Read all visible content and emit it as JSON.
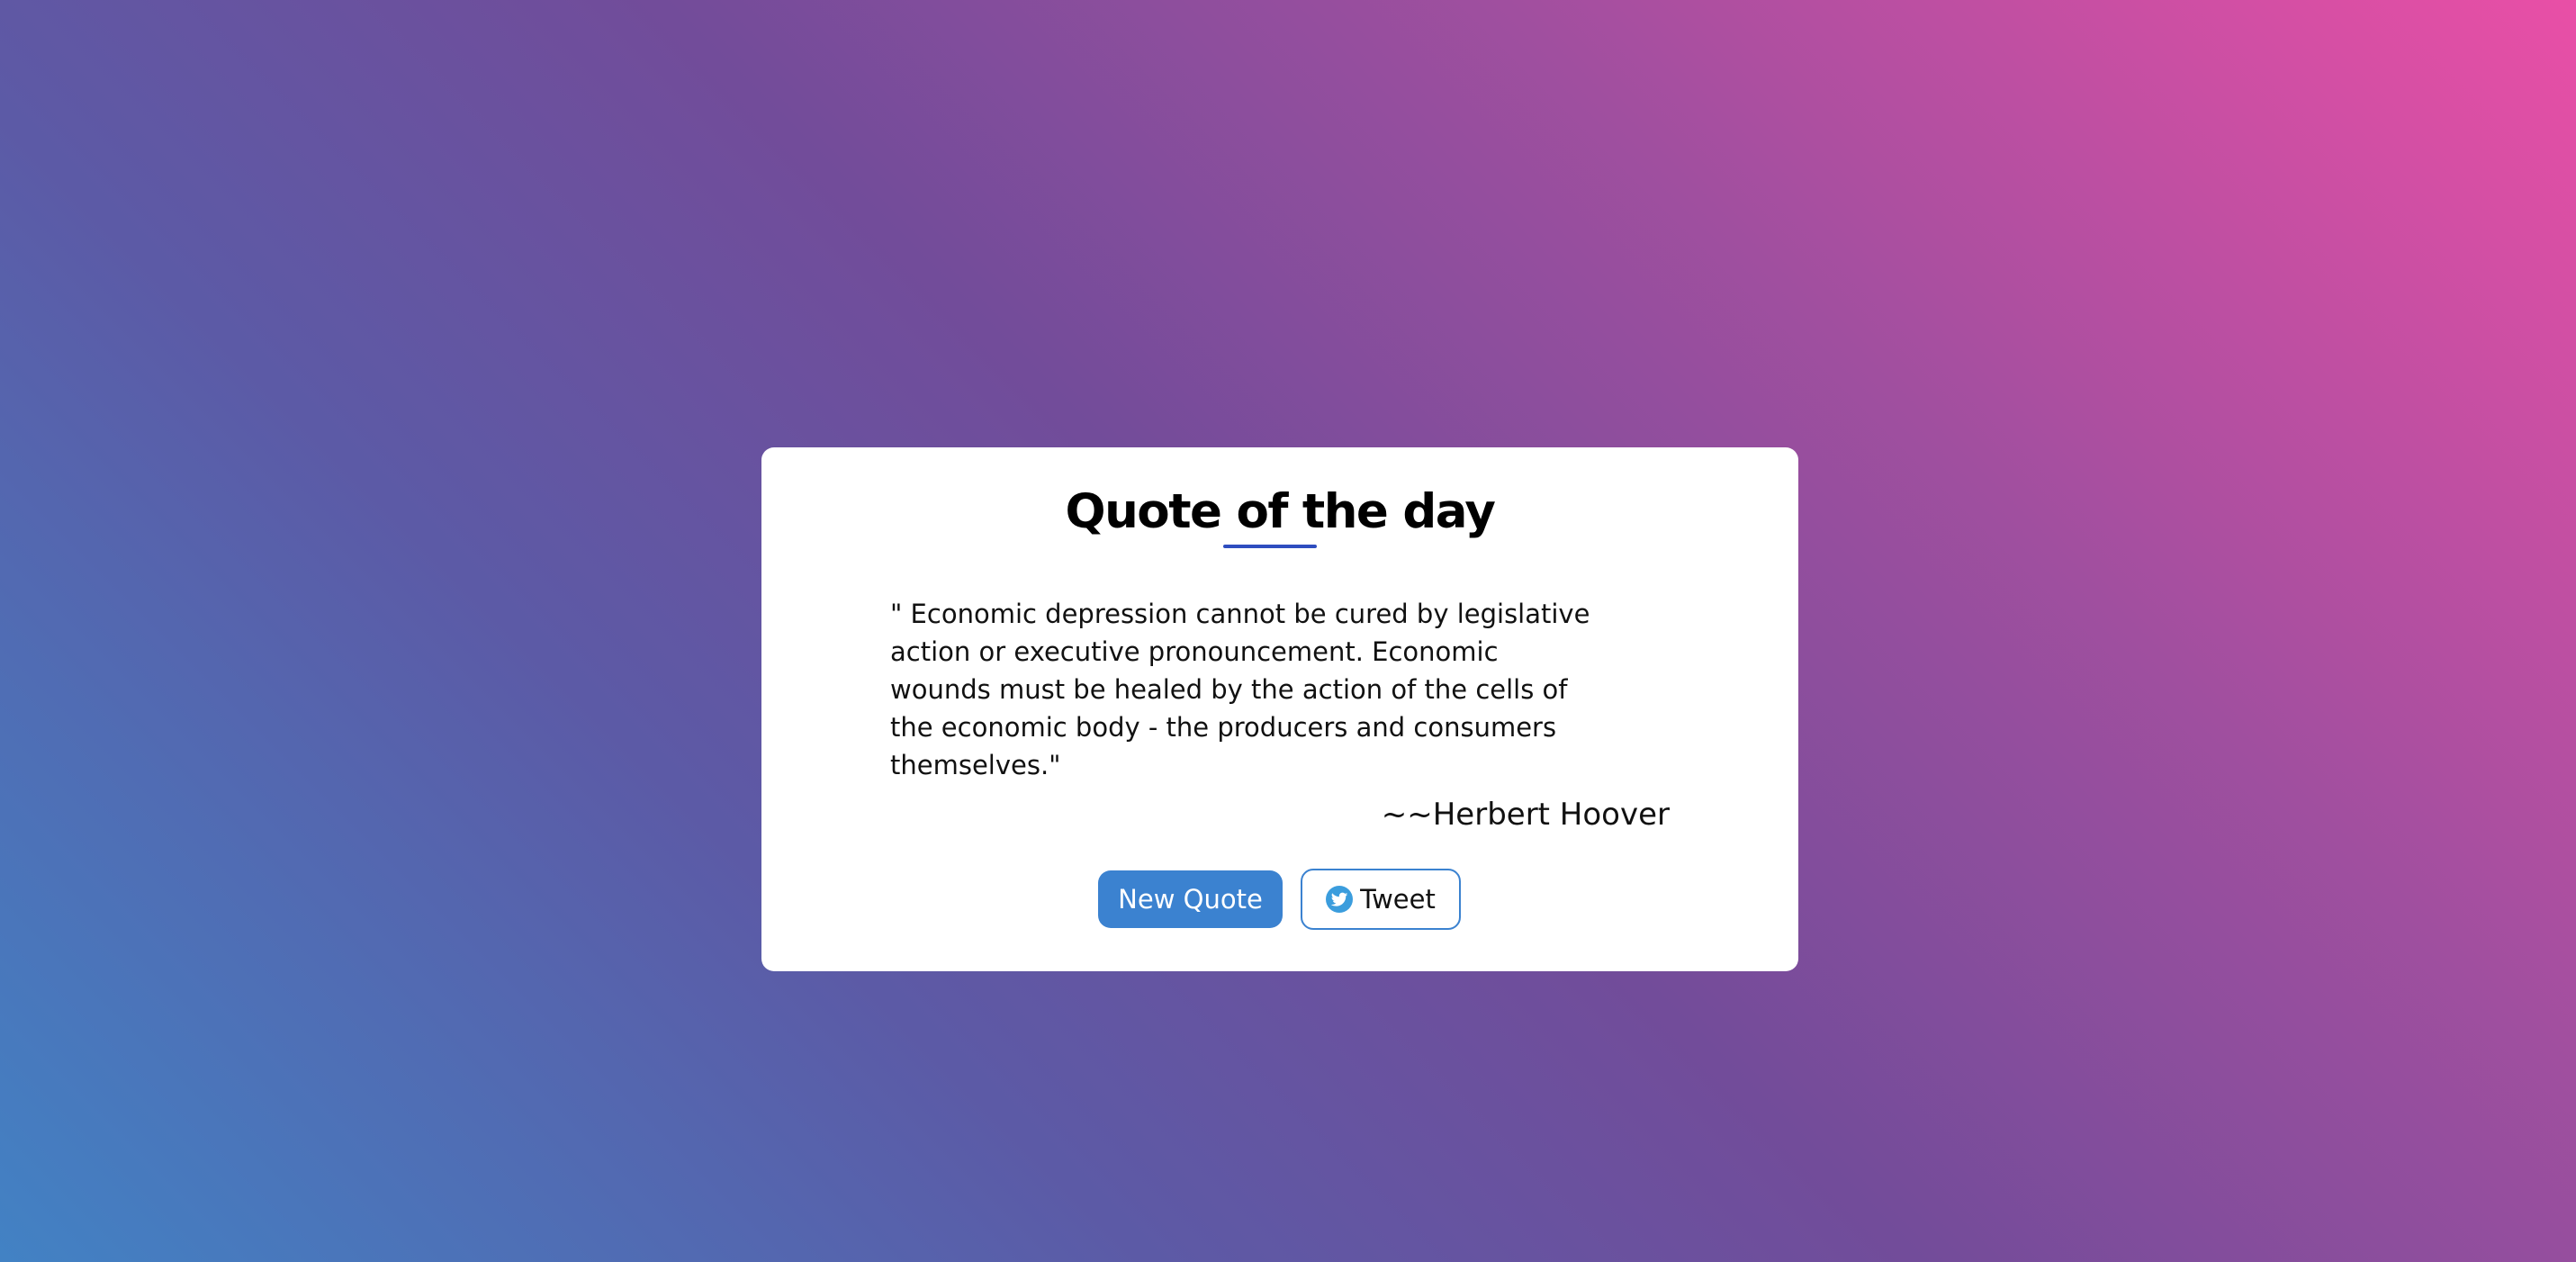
{
  "card": {
    "title": "Quote of the day",
    "quote": "\" Economic depression cannot be cured by legislative action or executive pronouncement. Economic wounds must be healed by the action of the cells of the economic body - the producers and consumers themselves.\"",
    "author": "~~Herbert Hoover"
  },
  "buttons": {
    "new_quote": "New Quote",
    "tweet": "Tweet"
  },
  "icons": {
    "tweet_icon": "twitter-bird-icon"
  },
  "colors": {
    "accent": "#3b82d0",
    "title_underline": "#2e4dbf",
    "twitter": "#3b9ddd"
  }
}
